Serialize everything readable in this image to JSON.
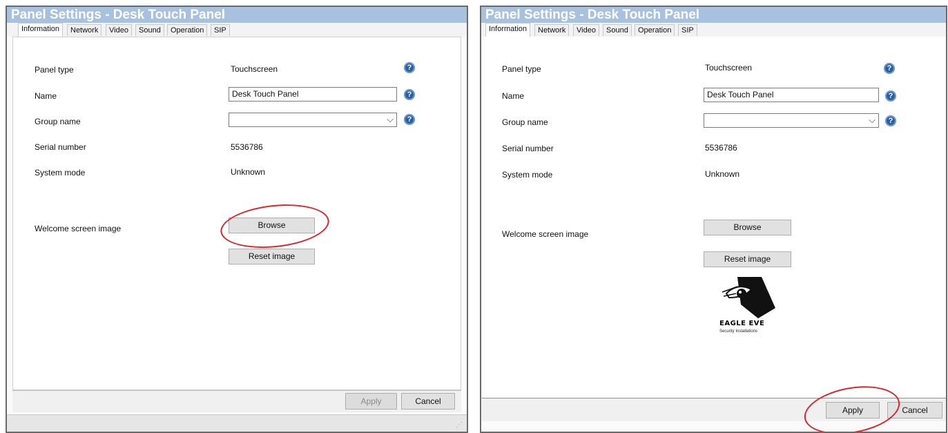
{
  "window": {
    "title": "Panel Settings - Desk Touch Panel"
  },
  "tabs": [
    "Information",
    "Network",
    "Video",
    "Sound",
    "Operation",
    "SIP"
  ],
  "form": {
    "panel_type_label": "Panel type",
    "panel_type_value": "Touchscreen",
    "name_label": "Name",
    "name_value": "Desk Touch Panel",
    "group_label": "Group name",
    "group_value": "",
    "serial_label": "Serial number",
    "serial_value": "5536786",
    "mode_label": "System mode",
    "mode_value": "Unknown",
    "welcome_label": "Welcome screen image",
    "browse_label": "Browse",
    "reset_label": "Reset image"
  },
  "footer": {
    "apply_label": "Apply",
    "cancel_label": "Cancel"
  },
  "logo": {
    "name": "EAGLE EVE",
    "tagline": "Security Installations"
  },
  "colors": {
    "titlebar": "#a8c1de",
    "highlight": "#d6262e",
    "help": "#2c5f9e"
  },
  "icons": {
    "help": "question-circle-icon",
    "dropdown": "chevron-down-icon"
  }
}
